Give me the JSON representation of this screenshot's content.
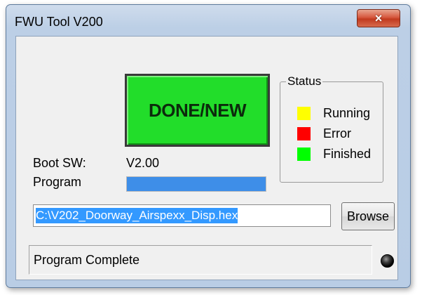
{
  "window": {
    "title": "FWU Tool V200",
    "close_label": "×"
  },
  "main": {
    "done_button_label": "DONE/NEW",
    "boot_sw_label": "Boot SW:",
    "boot_sw_value": "V2.00",
    "program_label": "Program",
    "program_progress": 1.0
  },
  "status_group": {
    "legend": "Status",
    "items": [
      {
        "label": "Running",
        "color": "#ffff00"
      },
      {
        "label": "Error",
        "color": "#ff0000"
      },
      {
        "label": "Finished",
        "color": "#00ff00"
      }
    ]
  },
  "file": {
    "path": "C:\\V202_Doorway_Airspexx_Disp.hex",
    "browse_label": "Browse"
  },
  "statusbar": {
    "message": "Program Complete",
    "led_color": "#000000"
  },
  "colors": {
    "done_button": "#22dd2a",
    "progress_fill": "#3e8ee8",
    "selection": "#3399ff"
  }
}
